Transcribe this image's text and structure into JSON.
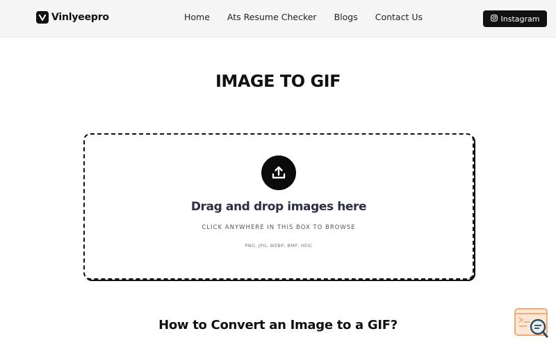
{
  "header": {
    "logo_text": "Vinlyeepro",
    "nav": [
      "Home",
      "Ats Resume Checker",
      "Blogs",
      "Contact Us"
    ],
    "instagram_label": "Instagram"
  },
  "main": {
    "title": "IMAGE TO GIF",
    "dropzone": {
      "heading": "Drag and drop images here",
      "subtext": "CLICK ANYWHERE IN THIS BOX TO BROWSE",
      "formats": "PNG, JPG, WEBP, BMP, HEIC"
    },
    "section_heading": "How to Convert an Image to a GIF?"
  },
  "icons": {
    "logo": "v-logo-icon",
    "instagram": "instagram-icon",
    "upload": "upload-icon",
    "widget": "search-widget-icon"
  },
  "colors": {
    "header_bg": "#f4f5f4",
    "primary_dark": "#111111",
    "heading_navy": "#2a2f45",
    "widget_orange": "#f0a36b"
  }
}
